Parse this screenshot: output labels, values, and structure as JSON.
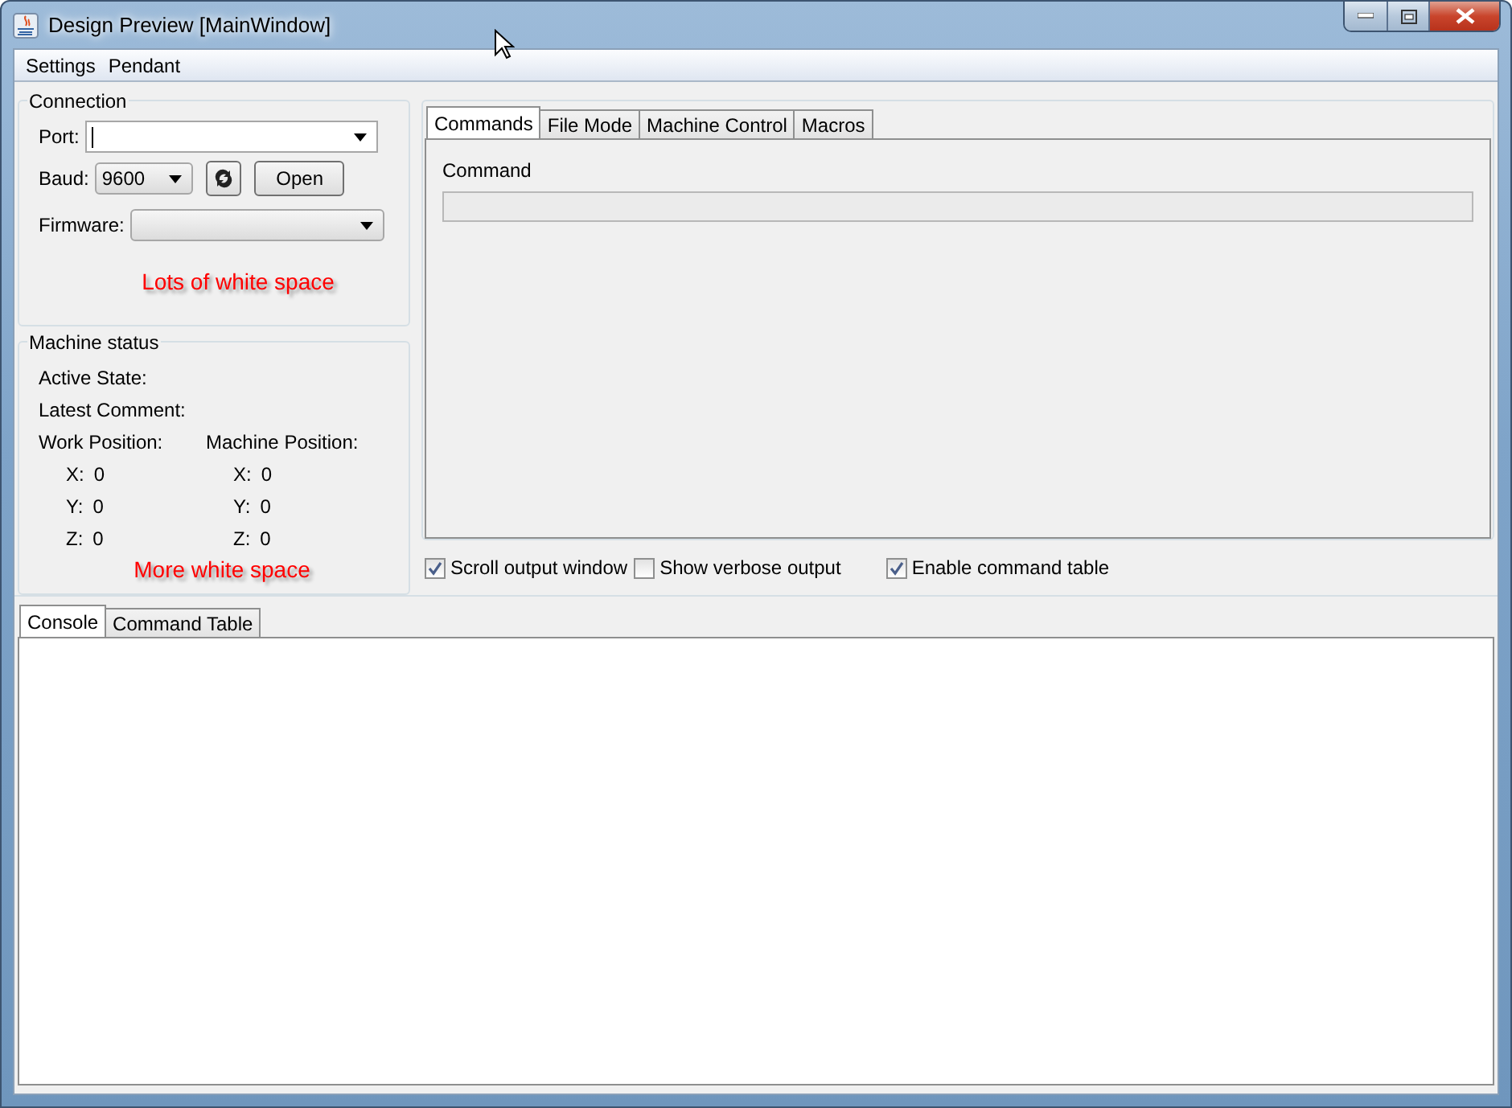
{
  "window": {
    "title": "Design Preview [MainWindow]"
  },
  "menu": [
    "Settings",
    "Pendant"
  ],
  "connection": {
    "title": "Connection",
    "port": {
      "label": "Port:"
    },
    "baud": {
      "label": "Baud:",
      "value": "9600"
    },
    "open_button": "Open",
    "firmware": {
      "label": "Firmware:"
    },
    "note": "Lots of white space"
  },
  "machine_status": {
    "title": "Machine status",
    "active_state": "Active State:",
    "latest_comment": "Latest Comment:",
    "work_position": {
      "label": "Work Position:",
      "axes": [
        {
          "axis": "X:",
          "value": "0"
        },
        {
          "axis": "Y:",
          "value": "0"
        },
        {
          "axis": "Z:",
          "value": "0"
        }
      ]
    },
    "machine_position": {
      "label": "Machine Position:",
      "axes": [
        {
          "axis": "X:",
          "value": "0"
        },
        {
          "axis": "Y:",
          "value": "0"
        },
        {
          "axis": "Z:",
          "value": "0"
        }
      ]
    },
    "note": "More white space"
  },
  "top_tabs": [
    {
      "label": "Commands",
      "selected": true
    },
    {
      "label": "File Mode",
      "selected": false
    },
    {
      "label": "Machine Control",
      "selected": false
    },
    {
      "label": "Macros",
      "selected": false
    }
  ],
  "command": {
    "label": "Command"
  },
  "options": [
    {
      "label": "Scroll output window",
      "checked": true
    },
    {
      "label": "Show verbose output",
      "checked": false
    },
    {
      "label": "Enable command table",
      "checked": true
    }
  ],
  "bottom_tabs": [
    {
      "label": "Console",
      "selected": true
    },
    {
      "label": "Command Table",
      "selected": false
    }
  ]
}
